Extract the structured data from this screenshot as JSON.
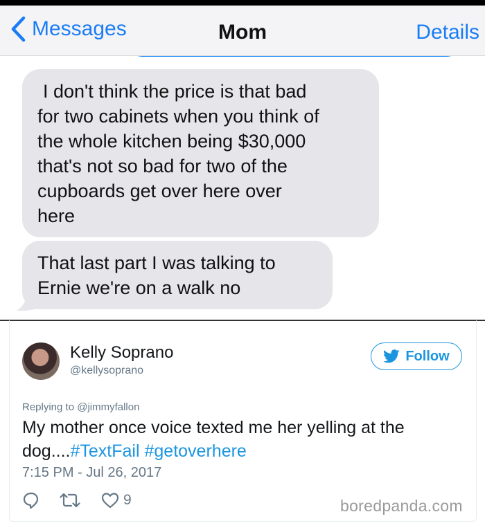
{
  "messages_app": {
    "back_label": "Messages",
    "title": "Mom",
    "details_label": "Details",
    "accent_color": "#1a7cf5",
    "bubbles": [
      {
        "lines": [
          "I don't think the price is that bad",
          "for two cabinets when you think of",
          "the whole kitchen being $30,000",
          "that's not so bad for two of the",
          "cupboards get over here over",
          "here"
        ]
      },
      {
        "lines": [
          "That last part I was talking to",
          "Ernie we're on a walk no"
        ]
      }
    ]
  },
  "tweet": {
    "author_name": "Kelly Soprano",
    "author_handle": "@kellysoprano",
    "follow_label": "Follow",
    "replying_to": "Replying to @jimmyfallon",
    "text_line1": "My mother once voice texted me her yelling at the",
    "text_line2_prefix": "dog....",
    "hashtags": [
      "#TextFail",
      "#getoverhere"
    ],
    "timestamp": "7:15 PM - Jul 26, 2017",
    "like_count": "9",
    "icons": [
      "reply-icon",
      "retweet-icon",
      "like-icon",
      "twitter-bird-icon"
    ],
    "link_color": "#1b95e0"
  },
  "watermark": "boredpanda.com"
}
